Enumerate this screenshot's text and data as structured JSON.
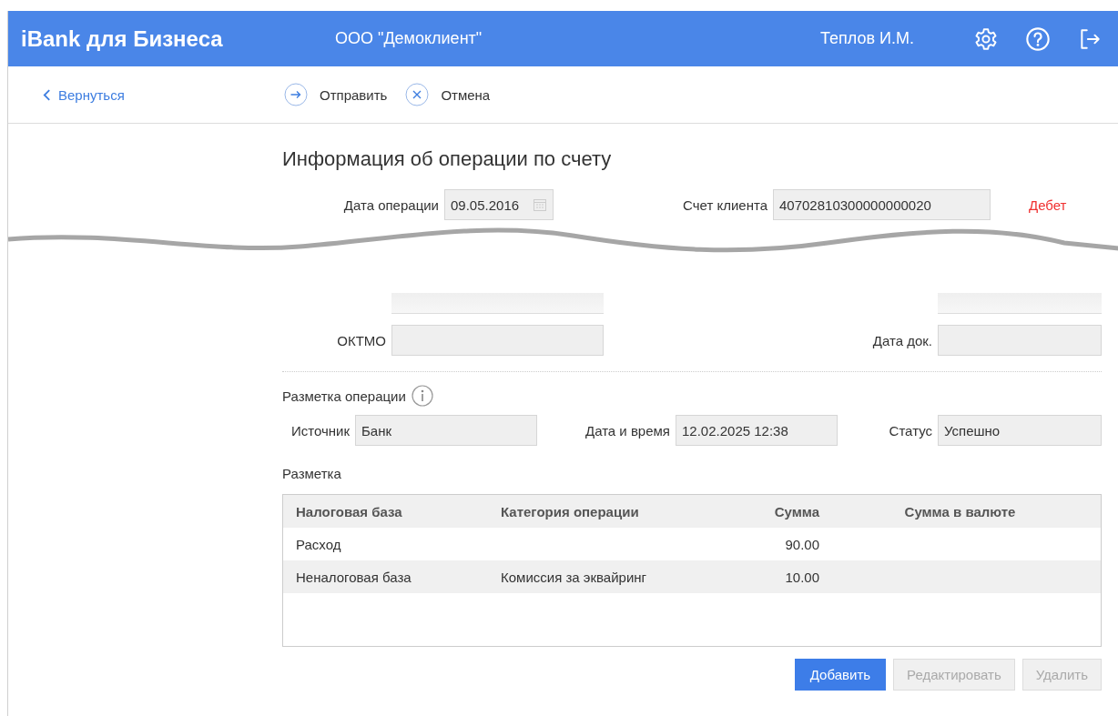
{
  "header": {
    "app_title": "iBank для Бизнеса",
    "organization": "ООО \"Демоклиент\"",
    "user": "Теплов И.М."
  },
  "toolbar": {
    "back": "Вернуться",
    "actions": [
      {
        "kind": "send",
        "label": "Отправить"
      },
      {
        "kind": "cancel",
        "label": "Отмена"
      }
    ]
  },
  "title": "Информация об операции по счету",
  "operation": {
    "date_label": "Дата операции",
    "date": "09.05.2016",
    "account_label": "Счет клиента",
    "account": "40702810300000000020",
    "direction": "Дебет"
  },
  "budget": {
    "oktmo_label": "ОКТМО",
    "doc_date_label": "Дата док."
  },
  "markup": {
    "title": "Разметка операции",
    "source_label": "Источник",
    "source": "Банк",
    "datetime_label": "Дата и время",
    "datetime": "12.02.2025 12:38",
    "status_label": "Статус",
    "status": "Успешно"
  },
  "table": {
    "title": "Разметка",
    "columns": [
      "Налоговая база",
      "Категория операции",
      "Сумма",
      "Сумма в валюте"
    ],
    "rows": [
      [
        "Расход",
        "",
        "90.00",
        ""
      ],
      [
        "Неналоговая база",
        "Комиссия за эквайринг",
        "10.00",
        ""
      ]
    ]
  },
  "buttons": [
    {
      "label": "Добавить",
      "disabled": false
    },
    {
      "label": "Редактировать",
      "disabled": true
    },
    {
      "label": "Удалить",
      "disabled": true
    }
  ]
}
